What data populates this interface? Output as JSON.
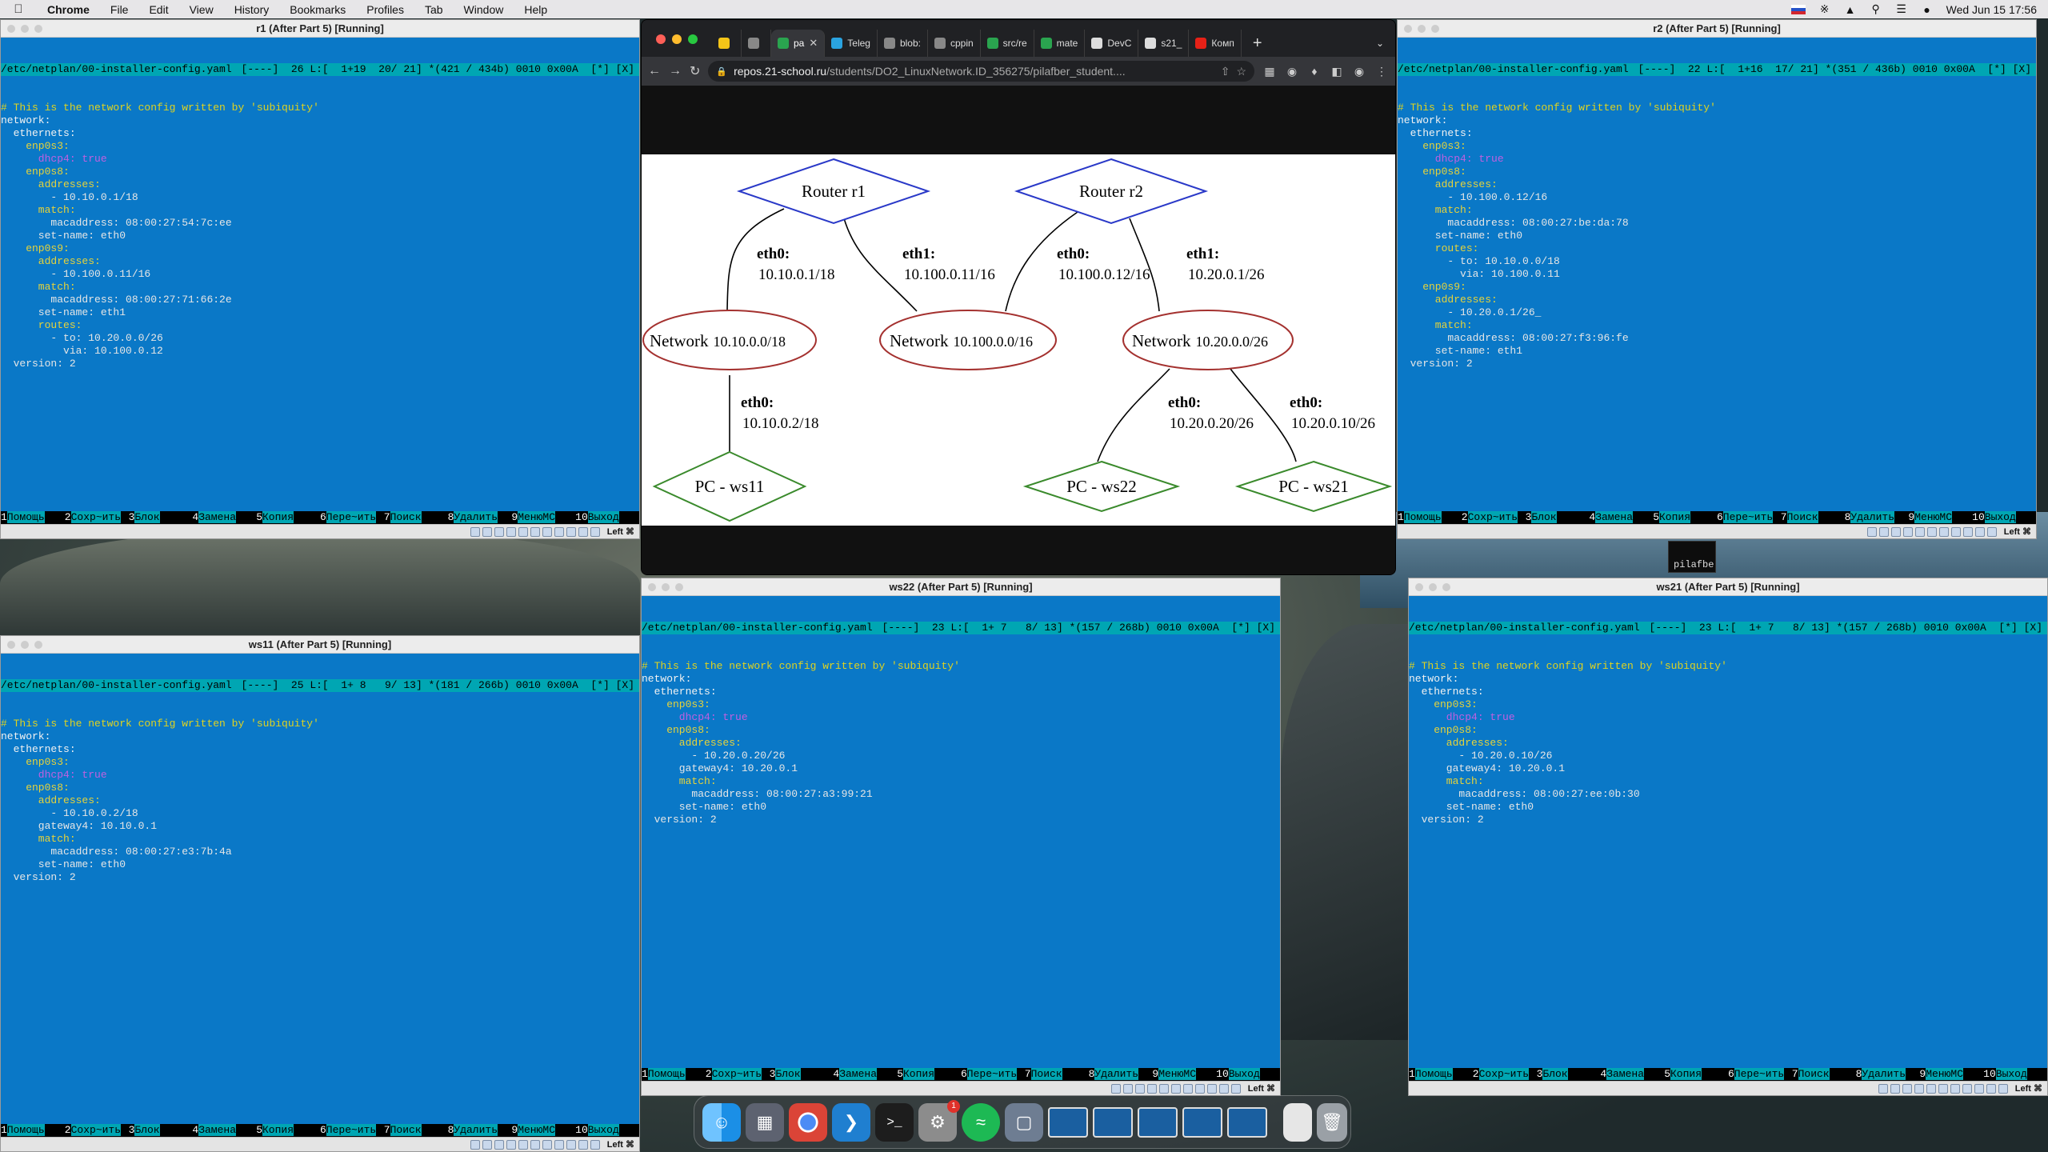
{
  "menubar": {
    "app": "Chrome",
    "items": [
      "File",
      "Edit",
      "View",
      "History",
      "Bookmarks",
      "Profiles",
      "Tab",
      "Window",
      "Help"
    ],
    "clock": "Wed Jun 15  17:56"
  },
  "fkeys": [
    {
      "n": "1",
      "l": "Помощь"
    },
    {
      "n": "2",
      "l": "Сохр~ить"
    },
    {
      "n": "3",
      "l": "Блок"
    },
    {
      "n": "4",
      "l": "Замена"
    },
    {
      "n": "5",
      "l": "Копия"
    },
    {
      "n": "6",
      "l": "Пере~ить"
    },
    {
      "n": "7",
      "l": "Поиск"
    },
    {
      "n": "8",
      "l": "Удалить"
    },
    {
      "n": "9",
      "l": "МенюMC"
    },
    {
      "n": "10",
      "l": "Выход"
    }
  ],
  "statusbar_host": "Left ⌘",
  "vm_r1": {
    "title": "r1 (After Part 5) [Running]",
    "status_left": "/etc/netplan/00-installer-config.yaml",
    "status_right": "[----]  26 L:[  1+19  20/ 21] *(421 / 434b) 0010 0x00A  [*] [X]",
    "lines": [
      {
        "t": "# This is the network config written by 'subiquity'",
        "c": "c-cm"
      },
      {
        "t": "network:",
        "c": "c-k"
      },
      {
        "t": "  ethernets:",
        "c": "c-k"
      },
      {
        "t": "    enp0s3:",
        "c": "c-s"
      },
      {
        "t": "      dhcp4: true",
        "c": "c-t"
      },
      {
        "t": "    enp0s8:",
        "c": "c-s"
      },
      {
        "t": "      addresses:",
        "c": "c-s"
      },
      {
        "t": "        - 10.10.0.1/18",
        "c": "c-v"
      },
      {
        "t": "      match:",
        "c": "c-s"
      },
      {
        "t": "        macaddress: 08:00:27:54:7c:ee",
        "c": "c-v"
      },
      {
        "t": "      set-name: eth0",
        "c": "c-v"
      },
      {
        "t": "    enp0s9:",
        "c": "c-s"
      },
      {
        "t": "      addresses:",
        "c": "c-s"
      },
      {
        "t": "        - 10.100.0.11/16",
        "c": "c-v"
      },
      {
        "t": "      match:",
        "c": "c-s"
      },
      {
        "t": "        macaddress: 08:00:27:71:66:2e",
        "c": "c-v"
      },
      {
        "t": "      set-name: eth1",
        "c": "c-v"
      },
      {
        "t": "      routes:",
        "c": "c-s"
      },
      {
        "t": "        - to: 10.20.0.0/26",
        "c": "c-v"
      },
      {
        "t": "          via: 10.100.0.12",
        "c": "c-v"
      },
      {
        "t": "  version: 2",
        "c": "c-v"
      }
    ]
  },
  "vm_r2": {
    "title": "r2 (After Part 5) [Running]",
    "status_left": "/etc/netplan/00-installer-config.yaml",
    "status_right": "[----]  22 L:[  1+16  17/ 21] *(351 / 436b) 0010 0x00A  [*] [X]",
    "lines": [
      {
        "t": "# This is the network config written by 'subiquity'",
        "c": "c-cm"
      },
      {
        "t": "network:",
        "c": "c-k"
      },
      {
        "t": "  ethernets:",
        "c": "c-k"
      },
      {
        "t": "    enp0s3:",
        "c": "c-s"
      },
      {
        "t": "      dhcp4: true",
        "c": "c-t"
      },
      {
        "t": "    enp0s8:",
        "c": "c-s"
      },
      {
        "t": "      addresses:",
        "c": "c-s"
      },
      {
        "t": "        - 10.100.0.12/16",
        "c": "c-v"
      },
      {
        "t": "      match:",
        "c": "c-s"
      },
      {
        "t": "        macaddress: 08:00:27:be:da:78",
        "c": "c-v"
      },
      {
        "t": "      set-name: eth0",
        "c": "c-v"
      },
      {
        "t": "      routes:",
        "c": "c-s"
      },
      {
        "t": "        - to: 10.10.0.0/18",
        "c": "c-v"
      },
      {
        "t": "          via: 10.100.0.11",
        "c": "c-v"
      },
      {
        "t": "    enp0s9:",
        "c": "c-s"
      },
      {
        "t": "      addresses:",
        "c": "c-s"
      },
      {
        "t": "        - 10.20.0.1/26_",
        "c": "c-v"
      },
      {
        "t": "      match:",
        "c": "c-s"
      },
      {
        "t": "        macaddress: 08:00:27:f3:96:fe",
        "c": "c-v"
      },
      {
        "t": "      set-name: eth1",
        "c": "c-v"
      },
      {
        "t": "  version: 2",
        "c": "c-v"
      }
    ]
  },
  "vm_ws11": {
    "title": "ws11 (After Part 5) [Running]",
    "status_left": "/etc/netplan/00-installer-config.yaml",
    "status_right": "[----]  25 L:[  1+ 8   9/ 13] *(181 / 266b) 0010 0x00A  [*] [X]",
    "lines": [
      {
        "t": "# This is the network config written by 'subiquity'",
        "c": "c-cm"
      },
      {
        "t": "network:",
        "c": "c-k"
      },
      {
        "t": "  ethernets:",
        "c": "c-k"
      },
      {
        "t": "    enp0s3:",
        "c": "c-s"
      },
      {
        "t": "      dhcp4: true",
        "c": "c-t"
      },
      {
        "t": "    enp0s8:",
        "c": "c-s"
      },
      {
        "t": "      addresses:",
        "c": "c-s"
      },
      {
        "t": "        - 10.10.0.2/18",
        "c": "c-v"
      },
      {
        "t": "      gateway4: 10.10.0.1",
        "c": "c-v"
      },
      {
        "t": "      match:",
        "c": "c-s"
      },
      {
        "t": "        macaddress: 08:00:27:e3:7b:4a",
        "c": "c-v"
      },
      {
        "t": "      set-name: eth0",
        "c": "c-v"
      },
      {
        "t": "  version: 2",
        "c": "c-v"
      }
    ]
  },
  "vm_ws22": {
    "title": "ws22 (After Part 5) [Running]",
    "status_left": "/etc/netplan/00-installer-config.yaml",
    "status_right": "[----]  23 L:[  1+ 7   8/ 13] *(157 / 268b) 0010 0x00A  [*] [X]",
    "lines": [
      {
        "t": "# This is the network config written by 'subiquity'",
        "c": "c-cm"
      },
      {
        "t": "network:",
        "c": "c-k"
      },
      {
        "t": "  ethernets:",
        "c": "c-k"
      },
      {
        "t": "    enp0s3:",
        "c": "c-s"
      },
      {
        "t": "      dhcp4: true",
        "c": "c-t"
      },
      {
        "t": "    enp0s8:",
        "c": "c-s"
      },
      {
        "t": "      addresses:",
        "c": "c-s"
      },
      {
        "t": "        - 10.20.0.20/26",
        "c": "c-v"
      },
      {
        "t": "      gateway4: 10.20.0.1",
        "c": "c-v"
      },
      {
        "t": "      match:",
        "c": "c-s"
      },
      {
        "t": "        macaddress: 08:00:27:a3:99:21",
        "c": "c-v"
      },
      {
        "t": "      set-name: eth0",
        "c": "c-v"
      },
      {
        "t": "  version: 2",
        "c": "c-v"
      }
    ]
  },
  "vm_ws21": {
    "title": "ws21 (After Part 5) [Running]",
    "status_left": "/etc/netplan/00-installer-config.yaml",
    "status_right": "[----]  23 L:[  1+ 7   8/ 13] *(157 / 268b) 0010 0x00A  [*] [X]",
    "lines": [
      {
        "t": "# This is the network config written by 'subiquity'",
        "c": "c-cm"
      },
      {
        "t": "network:",
        "c": "c-k"
      },
      {
        "t": "  ethernets:",
        "c": "c-k"
      },
      {
        "t": "    enp0s3:",
        "c": "c-s"
      },
      {
        "t": "      dhcp4: true",
        "c": "c-t"
      },
      {
        "t": "    enp0s8:",
        "c": "c-s"
      },
      {
        "t": "      addresses:",
        "c": "c-s"
      },
      {
        "t": "        - 10.20.0.10/26",
        "c": "c-v"
      },
      {
        "t": "      gateway4: 10.20.0.1",
        "c": "c-v"
      },
      {
        "t": "      match:",
        "c": "c-s"
      },
      {
        "t": "        macaddress: 08:00:27:ee:0b:30",
        "c": "c-v"
      },
      {
        "t": "      set-name: eth0",
        "c": "c-v"
      },
      {
        "t": "  version: 2",
        "c": "c-v"
      }
    ]
  },
  "browser": {
    "tabs": [
      {
        "label": "",
        "color": "#f5c518"
      },
      {
        "label": "",
        "color": "#888888"
      },
      {
        "label": "pa",
        "color": "#2aa44f",
        "active": true
      },
      {
        "label": "Teleg",
        "color": "#2aa3e0"
      },
      {
        "label": "blob:",
        "color": "#888888"
      },
      {
        "label": "cppin",
        "color": "#888888"
      },
      {
        "label": "src/re",
        "color": "#2aa44f"
      },
      {
        "label": "mate",
        "color": "#2aa44f"
      },
      {
        "label": "DevC",
        "color": "#dddddd"
      },
      {
        "label": "s21_",
        "color": "#dddddd"
      },
      {
        "label": "Комп",
        "color": "#e62117"
      }
    ],
    "url_host": "repos.21-school.ru",
    "url_path": "/students/DO2_LinuxNetwork.ID_356275/pilafber_student...."
  },
  "diagram": {
    "routers": [
      {
        "id": "r1",
        "label": "Router  r1"
      },
      {
        "id": "r2",
        "label": "Router  r2"
      }
    ],
    "networks": [
      {
        "id": "n1",
        "label": "Network",
        "addr": "10.10.0.0/18"
      },
      {
        "id": "n2",
        "label": "Network",
        "addr": "10.100.0.0/16"
      },
      {
        "id": "n3",
        "label": "Network",
        "addr": "10.20.0.0/26"
      }
    ],
    "pcs": [
      {
        "id": "ws11",
        "label": "PC - ws11"
      },
      {
        "id": "ws22",
        "label": "PC - ws22"
      },
      {
        "id": "ws21",
        "label": "PC - ws21"
      }
    ],
    "edges": [
      {
        "iface": "eth0:",
        "ip": "10.10.0.1/18"
      },
      {
        "iface": "eth1:",
        "ip": "10.100.0.11/16"
      },
      {
        "iface": "eth0:",
        "ip": "10.100.0.12/16"
      },
      {
        "iface": "eth1:",
        "ip": "10.20.0.1/26"
      },
      {
        "iface": "eth0:",
        "ip": "10.10.0.2/18"
      },
      {
        "iface": "eth0:",
        "ip": "10.20.0.20/26"
      },
      {
        "iface": "eth0:",
        "ip": "10.20.0.10/26"
      }
    ]
  },
  "peek_text": "pilafbe",
  "dock": {
    "badge": "1",
    "items": [
      "finder-icon",
      "launchpad-icon",
      "chrome-icon",
      "vscode-icon",
      "terminal-icon",
      "settings-icon",
      "spotify-icon",
      "virtualbox-icon"
    ]
  }
}
